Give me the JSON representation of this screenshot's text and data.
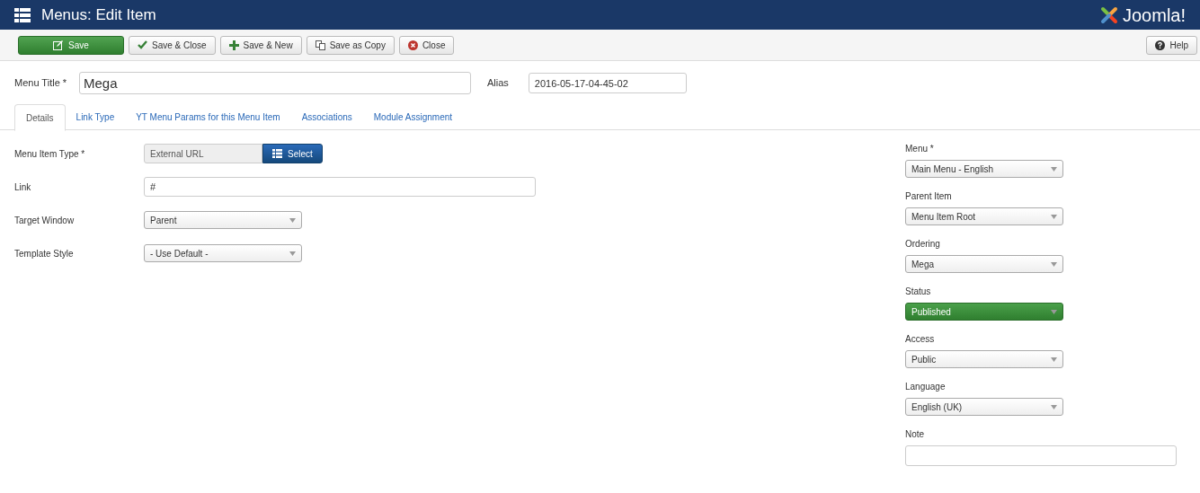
{
  "header": {
    "title": "Menus: Edit Item",
    "logo_text": "Joomla!"
  },
  "toolbar": {
    "buttons": [
      {
        "label": "Save",
        "kind": "primary"
      },
      {
        "label": "Save & Close",
        "kind": "default"
      },
      {
        "label": "Save & New",
        "kind": "default"
      },
      {
        "label": "Save as Copy",
        "kind": "default"
      },
      {
        "label": "Close",
        "kind": "default"
      }
    ],
    "help": {
      "label": "Help"
    }
  },
  "title_field": {
    "label": "Menu Title *",
    "value": "Mega"
  },
  "alias_field": {
    "label": "Alias",
    "value": "2016-05-17-04-45-02"
  },
  "tabs": [
    {
      "label": "Details",
      "selected": true
    },
    {
      "label": "Link Type",
      "selected": false
    },
    {
      "label": "YT Menu Params for this Menu Item",
      "selected": false
    },
    {
      "label": "Associations",
      "selected": false
    },
    {
      "label": "Module Assignment",
      "selected": false
    }
  ],
  "main_fields": [
    {
      "label": "Menu Item Type *",
      "kind": "picker",
      "value": "External URL",
      "button": "Select"
    },
    {
      "label": "Link",
      "kind": "text",
      "value": "#"
    },
    {
      "label": "Target Window",
      "kind": "select",
      "value": "Parent"
    },
    {
      "label": "Template Style",
      "kind": "select",
      "value": "- Use Default -"
    }
  ],
  "side_fields": [
    {
      "label": "Menu *",
      "kind": "select",
      "value": "Main Menu - English"
    },
    {
      "label": "Parent Item",
      "kind": "select",
      "value": "Menu Item Root"
    },
    {
      "label": "Ordering",
      "kind": "select",
      "value": "Mega"
    },
    {
      "label": "Status",
      "kind": "status",
      "value": "Published"
    },
    {
      "label": "Access",
      "kind": "select",
      "value": "Public"
    },
    {
      "label": "Language",
      "kind": "select",
      "value": "English (UK)"
    },
    {
      "label": "Note",
      "kind": "text"
    }
  ]
}
